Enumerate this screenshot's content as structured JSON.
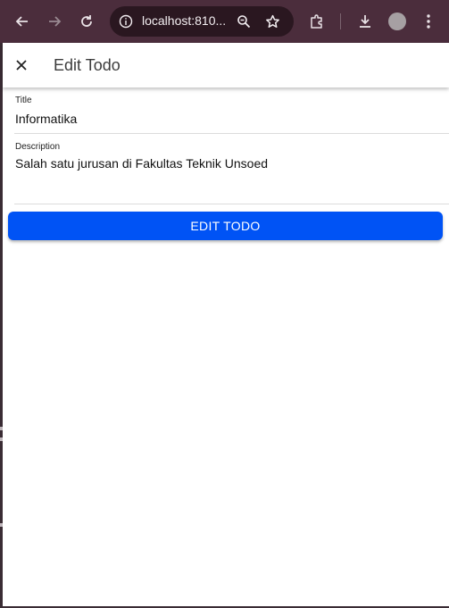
{
  "browser": {
    "url": "localhost:810...",
    "icons": [
      "back-arrow-icon",
      "forward-arrow-icon",
      "reload-icon",
      "site-info-icon",
      "zoom-icon",
      "star-icon",
      "extensions-icon",
      "download-icon",
      "profile-avatar",
      "more-menu-icon"
    ]
  },
  "appbar": {
    "title": "Edit Todo"
  },
  "form": {
    "title_label": "Title",
    "title_value": "Informatika",
    "description_label": "Description",
    "description_value": "Salah satu jurusan di Fakultas Teknik Unsoed",
    "submit_label": "EDIT TODO"
  },
  "colors": {
    "toolbar": "#4b2d3c",
    "button": "#0053f5"
  }
}
